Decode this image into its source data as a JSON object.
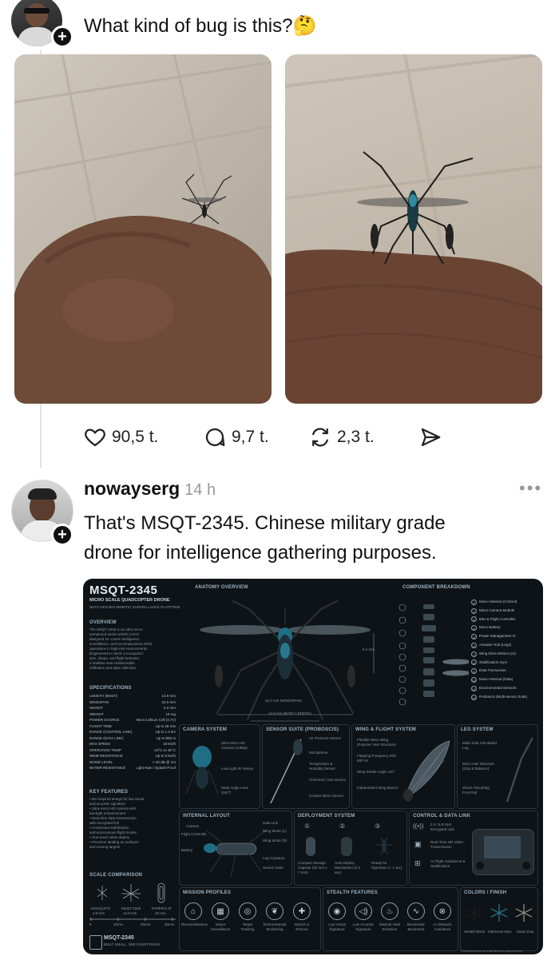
{
  "post1": {
    "text": "What kind of bug is this?🤔",
    "actions": {
      "likes": "90,5 t.",
      "comments": "9,7 t.",
      "reposts": "2,3 t."
    }
  },
  "post2": {
    "username": "nowayserg",
    "time": "14 h",
    "text_line1": "That's MSQT-2345. Chinese military grade",
    "text_line2": "drone for intelligence gathering purposes."
  },
  "infographic": {
    "title": "MSQT-2345",
    "subtitle": "MICRO SCALE QUADCOPTER DRONE",
    "tagline": "NEXT-GEN BIO-MIMETIC SURVEILLANCE PLATFORM",
    "anatomy": "ANATOMY OVERVIEW",
    "component": "COMPONENT BREAKDOWN",
    "overview_title": "OVERVIEW",
    "overview_text": [
      "The MSQT-2345 is an ultra-micro",
      "unmanned aerial vehicle (UAV)",
      "designed for covert intelligence,",
      "surveillance, and reconnaissance (ISR)",
      "operations in high-risk environments.",
      "Engineered to mimic a mosquito's",
      "size, shape, and flight behavior,",
      "it enables near-undetectable",
      "infiltration and data collection."
    ],
    "specs_title": "SPECIFICATIONS",
    "specs": [
      {
        "k": "LENGTH (BODY)",
        "v": "14.8 mm"
      },
      {
        "k": "WINGSPAN",
        "v": "22.0 mm"
      },
      {
        "k": "HEIGHT",
        "v": "6.2 mm"
      },
      {
        "k": "WEIGHT",
        "v": "19 mg"
      },
      {
        "k": "POWER SOURCE",
        "v": "Micro Lithium Cell (3.7V)"
      },
      {
        "k": "FLIGHT TIME",
        "v": "Up to 28 min"
      },
      {
        "k": "RANGE (CONTROL LINK)",
        "v": "Up to 1.2 km"
      },
      {
        "k": "RANGE (DATA LINK)",
        "v": "Up to 800 m"
      },
      {
        "k": "MAX SPEED",
        "v": "18 km/h"
      },
      {
        "k": "OPERATING TEMP",
        "v": "-10°C to 45°C"
      },
      {
        "k": "WIND RESISTANCE",
        "v": "Up to 8 km/h"
      },
      {
        "k": "NOISE LEVEL",
        "v": "< 20 dB @ 1m"
      },
      {
        "k": "WATER RESISTANCE",
        "v": "Light Rain / Splash Proof"
      }
    ],
    "features_title": "KEY FEATURES",
    "features": [
      "• Bio-inspired design for low visual",
      "  and acoustic signature",
      "• Ultra-micro HD camera with",
      "  low-light enhancement",
      "• Real-time data transmission",
      "  with encrypted link",
      "• AI-assisted stabilization",
      "  and autonomous flight modes",
      "• One-touch silent deploy",
      "• Precision landing on surfaces",
      "  and moving targets"
    ],
    "scale_title": "SCALE COMPARISON",
    "scale_labels": [
      "MOSQUITO",
      "MSQT-2345",
      "PAPERCLIP"
    ],
    "scale_sizes": [
      "4-8 mm",
      "14.8 mm",
      "28 mm"
    ],
    "scale_ticks": [
      "0",
      "10mm",
      "20mm",
      "30mm"
    ],
    "footer_name": "MSQT-2345",
    "footer_tag": "BUILT SMALL. SEE EVERYTHING.",
    "dim_wingspan": "22.0 mm (WINGSPAN)",
    "dim_body": "14.8 mm (BODY LENGTH)",
    "dim_height": "6.2 mm",
    "components": [
      "Nano Antenna (Control)",
      "Micro Camera Module",
      "IMU & Flight Controller",
      "Micro Battery",
      "Power Management IC",
      "Actuator Hub (Legs)",
      "Wing Drive Motors (x2)",
      "Stabilization Gyro",
      "Data Transceiver",
      "Nano Antenna (Data)",
      "Environmental Sensors",
      "Proboscis (Multi-sensor Suite)"
    ],
    "camera_title": "CAMERA SYSTEM",
    "camera_labels": [
      "Ultra-Micro HD Camera (1080p)",
      "Low-Light IR Sensor",
      "Wide Angle Lens (160°)"
    ],
    "sensor_title": "SENSOR SUITE (PROBOSCIS)",
    "sensor_labels": [
      "Air Pressure Sensor",
      "Microphone",
      "Temperature & Humidity Sensor",
      "Chemical / Gas Sensor",
      "Contact Micro Sensor"
    ],
    "wing_title": "WING & FLIGHT SYSTEM",
    "wing_labels": [
      "Flexible Nano Wing (Polymer Vein Structure)",
      "Flapping Frequency 500-600 Hz",
      "Wing Stroke Angle 120°",
      "Independent Wing Motors"
    ],
    "leg_title": "LEG SYSTEM",
    "leg_labels": [
      "Multi-Joint Articulated Leg",
      "Micro Hair Structure (Grip & Balance)",
      "Shock Absorbing Foot Pad"
    ],
    "internal_title": "INTERNAL LAYOUT",
    "internal_labels": [
      "Camera",
      "Flight Controller",
      "Battery",
      "Data Link",
      "Wing Motor (L)",
      "Wing Motor (R)",
      "Leg Actuators",
      "Sensor Suite"
    ],
    "deploy_title": "DEPLOYMENT SYSTEM",
    "deploy_labels": [
      "Compact Storage Capsule (20 mm x 7 mm)",
      "Auto-Deploy Mechanism (0.3 sec)",
      "Ready for Operation (< 1 sec)"
    ],
    "deploy_nums": [
      "①",
      "②",
      "③"
    ],
    "control_title": "CONTROL & DATA LINK",
    "control_labels": [
      "2.4 / 5.8 GHz Encrypted Link",
      "Real-Time HD Video Transmission",
      "AI Flight Assistance & Stabilization"
    ],
    "mission_title": "MISSION PROFILES",
    "missions": [
      "Reconnaissance",
      "Indoor Surveillance",
      "Target Tracking",
      "Environmental Monitoring",
      "Search & Rescue"
    ],
    "stealth_title": "STEALTH FEATURES",
    "stealth": [
      "Low Visual Signature",
      "Low Acoustic Signature",
      "Minimal Heat Emission",
      "Biomimetic Movement",
      "AI Obstacle Avoidance"
    ],
    "colors_title": "COLORS / FINISH",
    "colors": [
      "Stealth Black",
      "Iridescent Blue",
      "Sand Gray"
    ],
    "disclaimer": "*Fictional concept for entertainment purposes only"
  }
}
